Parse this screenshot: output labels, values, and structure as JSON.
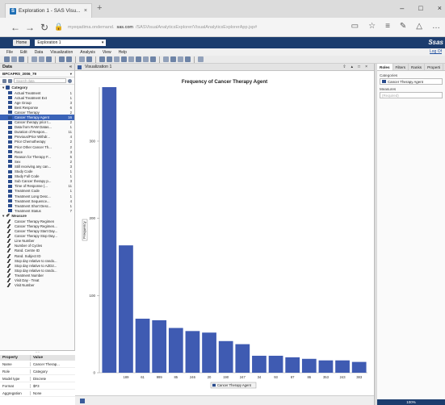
{
  "browser": {
    "tab_title": "Exploration 1 - SAS Visu...",
    "tab_close": "×",
    "new_tab": "+",
    "url_prefix": "myeqadima.ondemand.",
    "url_host": "sas.com",
    "url_path": "/SASVisualAnalyticsExplorer/VisualAnalyticsExplorerApp.jsp#",
    "win_min": "–",
    "win_max": "□",
    "win_close": "×"
  },
  "sas_header": {
    "home_label": "Home",
    "report_name": "Exploration 1",
    "logo": "Ssas",
    "logoff": "Log Of"
  },
  "menu": [
    "File",
    "Edit",
    "Data",
    "Visualization",
    "Analysis",
    "View",
    "Help"
  ],
  "data_pane": {
    "title": "Data",
    "dataset": "BPCAPRS_2006_79",
    "search_placeholder": "Search data",
    "category_group": "Category",
    "categories": [
      {
        "label": "Actual Treatment",
        "count": "1"
      },
      {
        "label": "Actual Treatment Ext",
        "count": "1"
      },
      {
        "label": "Age Group",
        "count": "3"
      },
      {
        "label": "Best Response",
        "count": "6"
      },
      {
        "label": "Cancer Therapy",
        "count": "2"
      },
      {
        "label": "Cancer Therapy Agent",
        "count": "16"
      },
      {
        "label": "Cancer therapy prior t...",
        "count": "2"
      },
      {
        "label": "Data from RAW Datas...",
        "count": "1"
      },
      {
        "label": "Duration of Respon...",
        "count": "11"
      },
      {
        "label": "Previous/Prior Withdr...",
        "count": "4"
      },
      {
        "label": "Prior Chemotherapy",
        "count": "2"
      },
      {
        "label": "Prior Other Cancer Th...",
        "count": "2"
      },
      {
        "label": "Race",
        "count": "3"
      },
      {
        "label": "Reason for Therapy F...",
        "count": "5"
      },
      {
        "label": "Sex",
        "count": "2"
      },
      {
        "label": "Still receiving any can...",
        "count": "3"
      },
      {
        "label": "Study Code",
        "count": "1"
      },
      {
        "label": "Study Full Code",
        "count": "1"
      },
      {
        "label": "Sub Cancer therapy p...",
        "count": "3"
      },
      {
        "label": "Time of Response (...",
        "count": "11"
      },
      {
        "label": "Treatment Code",
        "count": "1"
      },
      {
        "label": "Treatment Long Desc...",
        "count": "1"
      },
      {
        "label": "Treatment Sequence...",
        "count": "4"
      },
      {
        "label": "Treatment Short Desc...",
        "count": "1"
      },
      {
        "label": "Treatment Status",
        "count": "7"
      }
    ],
    "selected_index": 5,
    "measure_group": "Measure",
    "measures": [
      "Cancer Therapy Regimen",
      "Cancer Therapy Regimen...",
      "Cancer Therapy Start Day...",
      "Cancer Therapy Stop Day...",
      "Line Number",
      "Number of Cycles",
      "Rand. Centre ID",
      "Rand. Subject ID",
      "Stop day relative to rando...",
      "Stop day relative to AZD2...",
      "Stop day relative to rando...",
      "Treatment Number",
      "Visit Day - Treat",
      "Visit Number"
    ]
  },
  "properties": {
    "grip": "....",
    "header_property": "Property",
    "header_value": "Value",
    "rows": [
      {
        "property": "Name",
        "value": "Cancer Therap..."
      },
      {
        "property": "Role",
        "value": "Category"
      },
      {
        "property": "Model type",
        "value": "Discrete"
      },
      {
        "property": "Format",
        "value": "$F3"
      },
      {
        "property": "Aggregation",
        "value": "None"
      }
    ]
  },
  "visualization": {
    "tab_label": "Visualization 1",
    "controls": [
      "⇧",
      "▴",
      "□",
      "×"
    ],
    "axis_button": "Cancer Therapy Agent"
  },
  "chart_data": {
    "type": "bar",
    "title": "Frequency of Cancer Therapy Agent",
    "ylabel": "Frequency",
    "xlabel": "",
    "categories": [
      "",
      "189",
      "61",
      "999",
      "85",
      "246",
      "20",
      "190",
      "247",
      "34",
      "93",
      "87",
      "86",
      "353",
      "243",
      "383"
    ],
    "values": [
      370,
      165,
      70,
      68,
      58,
      54,
      52,
      41,
      37,
      22,
      22,
      20,
      18,
      16,
      16,
      14
    ],
    "ylim": [
      0,
      370
    ],
    "yticks": [
      0,
      100,
      200,
      300
    ],
    "bar_color": "#3f5bb2",
    "grid": false
  },
  "roles_pane": {
    "tabs": [
      "Roles",
      "Filters",
      "Ranks",
      "Properti"
    ],
    "category_label": "Categories",
    "category_value": "Cancer Therapy Agent",
    "measures_label": "Measures",
    "measures_placeholder": "(Required)",
    "bottom_label": "100%"
  },
  "colors": {
    "sas_header": "#1c3d6e",
    "selected": "#3a63b8",
    "bar": "#3f5bb2"
  }
}
